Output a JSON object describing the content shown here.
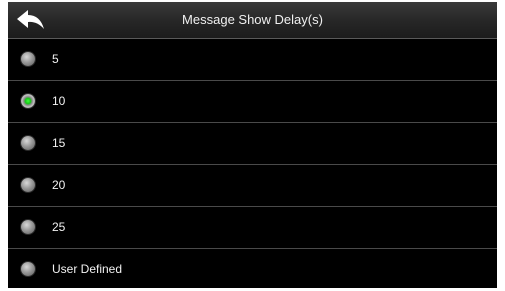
{
  "header": {
    "title": "Message Show Delay(s)",
    "back_icon": "back-arrow-icon"
  },
  "options": [
    {
      "label": "5",
      "selected": false
    },
    {
      "label": "10",
      "selected": true
    },
    {
      "label": "15",
      "selected": false
    },
    {
      "label": "20",
      "selected": false
    },
    {
      "label": "25",
      "selected": false
    },
    {
      "label": "User Defined",
      "selected": false
    }
  ],
  "colors": {
    "background": "#000000",
    "header": "#2a2a2a",
    "text": "#f2f2f2",
    "selected_indicator": "#22dd22",
    "divider": "#4a4a4a"
  }
}
